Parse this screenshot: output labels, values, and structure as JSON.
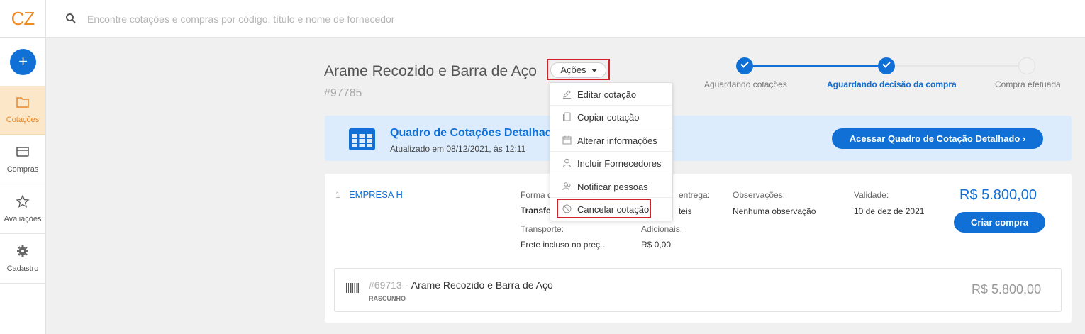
{
  "logo": "CZ",
  "search": {
    "placeholder": "Encontre cotações e compras por código, título e nome de fornecedor"
  },
  "sidebar": {
    "new_label": "+",
    "items": [
      {
        "label": "Cotações",
        "icon": "folder-icon",
        "active": true
      },
      {
        "label": "Compras",
        "icon": "card-icon",
        "active": false
      },
      {
        "label": "Avaliações",
        "icon": "star-icon",
        "active": false
      },
      {
        "label": "Cadastro",
        "icon": "gear-icon",
        "active": false
      }
    ]
  },
  "quotation": {
    "title": "Arame Recozido e Barra de Aço",
    "id": "#97785",
    "actions_label": "Ações"
  },
  "stepper": {
    "steps": [
      {
        "label": "Aguardando cotações",
        "state": "done"
      },
      {
        "label": "Aguardando decisão da compra",
        "state": "current"
      },
      {
        "label": "Compra efetuada",
        "state": "todo"
      }
    ]
  },
  "actions_menu": [
    {
      "label": "Editar cotação",
      "icon": "pencil-icon"
    },
    {
      "label": "Copiar cotação",
      "icon": "copy-icon"
    },
    {
      "label": "Alterar informações",
      "icon": "calendar-icon"
    },
    {
      "label": "Incluir Fornecedores",
      "icon": "person-icon"
    },
    {
      "label": "Notificar pessoas",
      "icon": "people-icon"
    },
    {
      "label": "Cancelar cotação",
      "icon": "ban-icon"
    }
  ],
  "banner": {
    "title": "Quadro de Cotações Detalhado",
    "updated": "Atualizado em 08/12/2021, às 12:11",
    "button": "Acessar Quadro de Cotação Detalhado  ›"
  },
  "supplier": {
    "index": "1",
    "name": "EMPRESA H",
    "payment_label": "Forma d",
    "payment_value": "Transfe",
    "delivery_label": "entrega:",
    "delivery_value": "teis",
    "notes_label": "Observações:",
    "notes_value": "Nenhuma observação",
    "validity_label": "Validade:",
    "validity_value": "10 de dez de 2021",
    "transport_label": "Transporte:",
    "transport_value": "Frete incluso no preç...",
    "extras_label": "Adicionais:",
    "extras_value": "R$ 0,00",
    "total": "R$ 5.800,00",
    "buy_button": "Criar compra"
  },
  "item": {
    "code": "#69713",
    "name": "- Arame Recozido e Barra de Aço",
    "status": "RASCUNHO",
    "price": "R$ 5.800,00"
  },
  "colors": {
    "primary": "#1170d6",
    "accent": "#f08a24",
    "highlight": "#d4202b",
    "banner_bg": "#dcecfc"
  }
}
